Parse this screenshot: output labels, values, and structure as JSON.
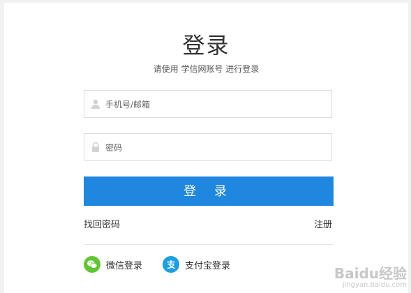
{
  "title": "登录",
  "subtitle": "请使用 学信网账号 进行登录",
  "account_field": {
    "placeholder": "手机号/邮箱",
    "value": "",
    "icon": "user-icon"
  },
  "password_field": {
    "placeholder": "密码",
    "value": "",
    "icon": "lock-icon"
  },
  "login_button": "登 录",
  "links": {
    "forgot_password": "找回密码",
    "register": "注册"
  },
  "social": {
    "wechat": {
      "label": "微信登录",
      "icon": "wechat-icon",
      "color": "#5fc72f"
    },
    "alipay": {
      "label": "支付宝登录",
      "icon": "alipay-icon",
      "color": "#1aa0e2"
    }
  },
  "watermark": {
    "brand": "Baidu经验",
    "url": "jingyan.baidu.com"
  },
  "colors": {
    "primary": "#1f87df",
    "background": "#f2f2f2"
  }
}
